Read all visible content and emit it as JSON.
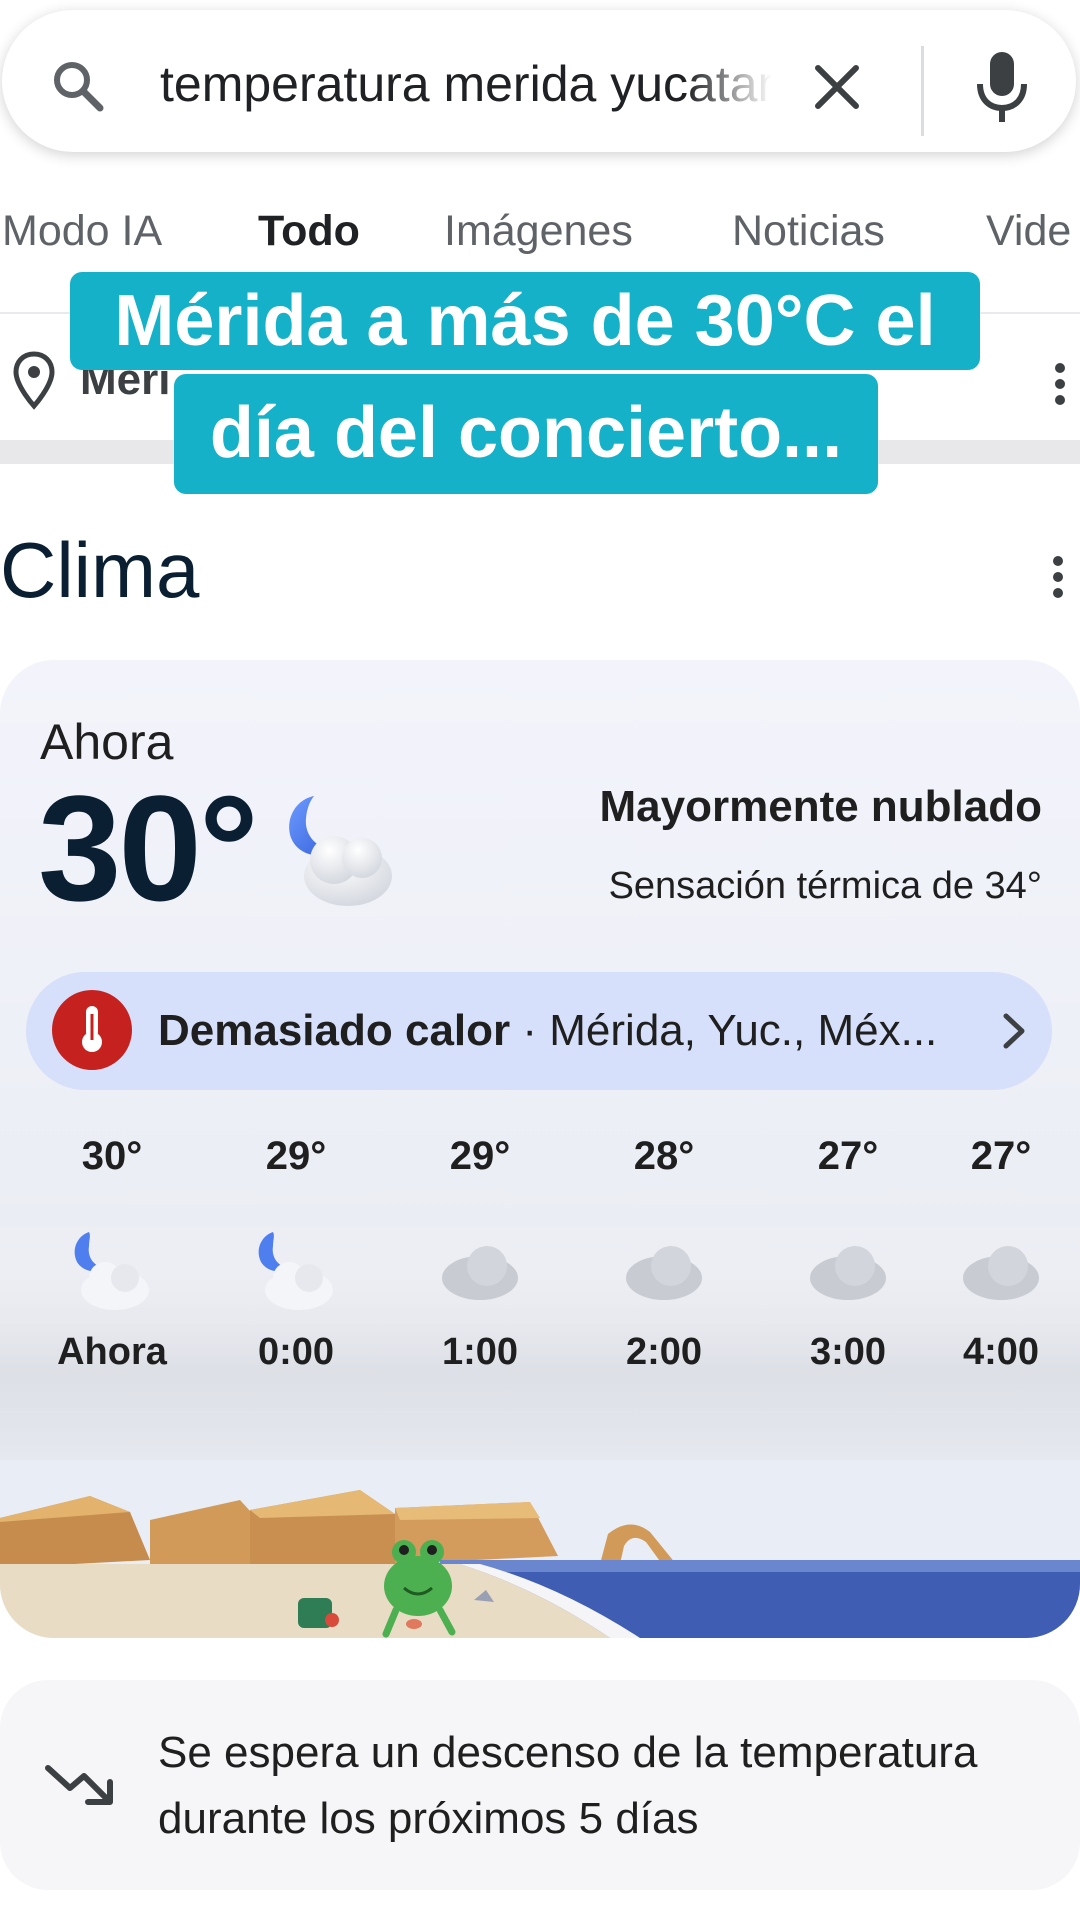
{
  "search": {
    "query": "temperatura merida yucatan"
  },
  "tabs": [
    {
      "label": "Modo IA"
    },
    {
      "label": "Todo"
    },
    {
      "label": "Imágenes"
    },
    {
      "label": "Noticias"
    },
    {
      "label": "Vide"
    }
  ],
  "location": {
    "label": "Méri"
  },
  "caption": {
    "line1": "Mérida a más de 30°C el",
    "line2": "día del concierto..."
  },
  "clima": {
    "title": "Clima"
  },
  "current": {
    "label": "Ahora",
    "temp": "30°",
    "condition": "Mayormente nublado",
    "feels_like": "Sensación térmica de 34°",
    "icon": "moon-cloud-icon"
  },
  "alert": {
    "title": "Demasiado calor",
    "separator": " · ",
    "place": "Mérida, Yuc., Méx...",
    "icon": "thermometer-icon",
    "color": "#c5221f"
  },
  "hourly": [
    {
      "temp": "30°",
      "time": "Ahora",
      "icon": "moon-cloud-icon"
    },
    {
      "temp": "29°",
      "time": "0:00",
      "icon": "moon-cloud-icon"
    },
    {
      "temp": "29°",
      "time": "1:00",
      "icon": "cloud-icon"
    },
    {
      "temp": "28°",
      "time": "2:00",
      "icon": "cloud-icon"
    },
    {
      "temp": "27°",
      "time": "3:00",
      "icon": "cloud-icon"
    },
    {
      "temp": "27°",
      "time": "4:00",
      "icon": "cloud-icon"
    }
  ],
  "forecast_note": {
    "text": "Se espera un descenso de la temperatura durante los próximos 5 días"
  },
  "colors": {
    "caption_bg": "#14b1c8",
    "alert_bg": "#d6e0fb",
    "title": "#0b1f33"
  }
}
